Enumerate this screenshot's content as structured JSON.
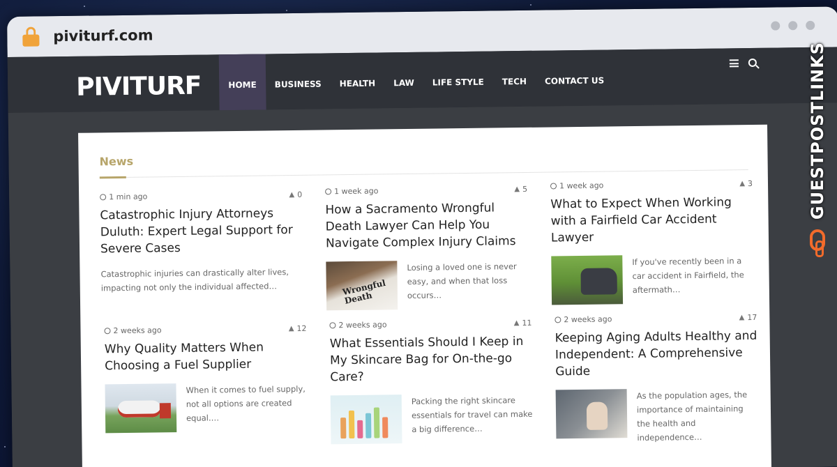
{
  "browser": {
    "url": "piviturf.com"
  },
  "site": {
    "logo": "PIVITURF",
    "nav": [
      {
        "label": "HOME",
        "active": true
      },
      {
        "label": "BUSINESS",
        "active": false
      },
      {
        "label": "HEALTH",
        "active": false
      },
      {
        "label": "LAW",
        "active": false
      },
      {
        "label": "LIFE STYLE",
        "active": false
      },
      {
        "label": "TECH",
        "active": false
      },
      {
        "label": "CONTACT US",
        "active": false
      }
    ]
  },
  "section": {
    "title": "News"
  },
  "posts": [
    {
      "time": "1 min ago",
      "count": "0",
      "title": "Catastrophic Injury Attorneys Duluth: Expert Legal Support for Severe Cases",
      "excerpt": "Catastrophic injuries can drastically alter lives, impacting not only the individual affected…",
      "thumb": null
    },
    {
      "time": "1 week ago",
      "count": "5",
      "title": "How a Sacramento Wrongful Death Lawyer Can Help You Navigate Complex Injury Claims",
      "excerpt": "Losing a loved one is never easy, and when that loss occurs…",
      "thumb": "wrongful-death",
      "thumb_text": "Wrongful Death"
    },
    {
      "time": "1 week ago",
      "count": "3",
      "title": "What to Expect When Working with a Fairfield Car Accident Lawyer",
      "excerpt": "If you've recently been in a car accident in Fairfield, the aftermath…",
      "thumb": "car-accident"
    },
    {
      "time": "2 weeks ago",
      "count": "12",
      "title": "Why Quality Matters When Choosing a Fuel Supplier",
      "excerpt": "When it comes to fuel supply, not all options are created equal.…",
      "thumb": "fuel-truck"
    },
    {
      "time": "2 weeks ago",
      "count": "11",
      "title": "What Essentials Should I Keep in My Skincare Bag for On-the-go Care?",
      "excerpt": "Packing the right skincare essentials for travel can make a big difference…",
      "thumb": "skincare"
    },
    {
      "time": "2 weeks ago",
      "count": "17",
      "title": "Keeping Aging Adults Healthy and Independent: A Comprehensive Guide",
      "excerpt": "As the population ages, the importance of maintaining the health and independence…",
      "thumb": "aging-adults"
    }
  ],
  "watermark": {
    "text": "GUESTPOSTLINKS"
  },
  "colors": {
    "accent": "#b7a56a",
    "nav_bg": "#2f3238",
    "nav_active": "#443f58",
    "watermark_icon": "#f36b2b"
  }
}
